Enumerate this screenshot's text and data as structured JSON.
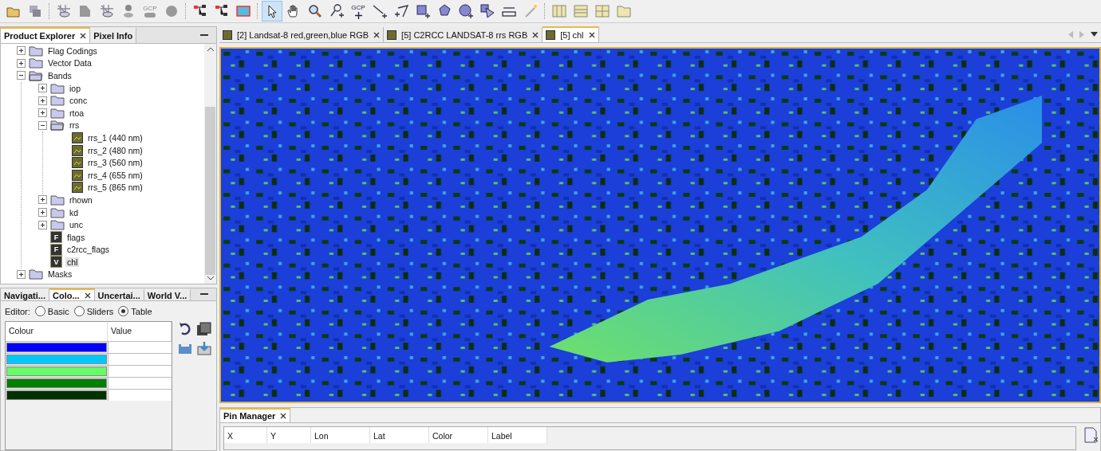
{
  "toolbar": [
    {
      "kind": "open",
      "selected": false
    },
    {
      "kind": "session",
      "selected": false
    },
    {
      "kind": "sep"
    },
    {
      "kind": "hide",
      "selected": false
    },
    {
      "kind": "shape",
      "selected": false
    },
    {
      "kind": "grid",
      "selected": false
    },
    {
      "kind": "pin",
      "selected": false
    },
    {
      "kind": "gcp",
      "label": "GCP",
      "selected": false
    },
    {
      "kind": "blob",
      "selected": false
    },
    {
      "kind": "sep"
    },
    {
      "kind": "graph",
      "selected": false
    },
    {
      "kind": "graph2",
      "selected": false
    },
    {
      "kind": "map",
      "selected": false
    },
    {
      "kind": "sep"
    },
    {
      "kind": "select",
      "selected": true
    },
    {
      "kind": "pan",
      "selected": false
    },
    {
      "kind": "zoom",
      "selected": false
    },
    {
      "kind": "pinadd",
      "selected": false
    },
    {
      "kind": "gcpadd",
      "label": "GCP",
      "selected": false
    },
    {
      "kind": "line",
      "selected": false
    },
    {
      "kind": "polyline",
      "selected": false
    },
    {
      "kind": "rect",
      "selected": false
    },
    {
      "kind": "polygon",
      "selected": false
    },
    {
      "kind": "ellipse",
      "selected": false
    },
    {
      "kind": "shape2",
      "selected": false
    },
    {
      "kind": "ruler",
      "selected": false
    },
    {
      "kind": "wand",
      "selected": false
    },
    {
      "kind": "sep"
    },
    {
      "kind": "tilev",
      "selected": false
    },
    {
      "kind": "tileh",
      "selected": false
    },
    {
      "kind": "tileg",
      "selected": false
    },
    {
      "kind": "folder",
      "selected": false
    }
  ],
  "explorer": {
    "tabs": [
      {
        "label": "Product Explorer",
        "selected": true,
        "closable": true
      },
      {
        "label": "Pixel Info",
        "selected": false,
        "closable": false
      }
    ],
    "tree": [
      {
        "label": "Flag Codings",
        "kind": "folder",
        "expanded": false
      },
      {
        "label": "Vector Data",
        "kind": "folder",
        "expanded": false
      },
      {
        "label": "Bands",
        "kind": "folder",
        "expanded": true,
        "children": [
          {
            "label": "iop",
            "kind": "folder",
            "expanded": false
          },
          {
            "label": "conc",
            "kind": "folder",
            "expanded": false
          },
          {
            "label": "rtoa",
            "kind": "folder",
            "expanded": false
          },
          {
            "label": "rrs",
            "kind": "folder",
            "expanded": true,
            "children": [
              {
                "label": "rrs_1 (440 nm)",
                "kind": "band"
              },
              {
                "label": "rrs_2 (480 nm)",
                "kind": "band"
              },
              {
                "label": "rrs_3 (560 nm)",
                "kind": "band"
              },
              {
                "label": "rrs_4 (655 nm)",
                "kind": "band"
              },
              {
                "label": "rrs_5 (865 nm)",
                "kind": "band"
              }
            ]
          },
          {
            "label": "rhown",
            "kind": "folder",
            "expanded": false
          },
          {
            "label": "kd",
            "kind": "folder",
            "expanded": false
          },
          {
            "label": "unc",
            "kind": "folder",
            "expanded": false
          },
          {
            "label": "flags",
            "kind": "flag",
            "icon_letter": "F"
          },
          {
            "label": "c2rcc_flags",
            "kind": "flag",
            "icon_letter": "F"
          },
          {
            "label": "chl",
            "kind": "virtual",
            "icon_letter": "V",
            "selected": true
          }
        ]
      },
      {
        "label": "Masks",
        "kind": "folder",
        "expanded": false
      }
    ]
  },
  "colour_panel": {
    "tabs": [
      {
        "label": "Navigati...",
        "selected": false,
        "closable": false
      },
      {
        "label": "Colo...",
        "selected": true,
        "closable": true
      },
      {
        "label": "Uncertai...",
        "selected": false,
        "closable": false
      },
      {
        "label": "World V...",
        "selected": false,
        "closable": false
      }
    ],
    "editor_label": "Editor:",
    "editors": [
      {
        "label": "Basic",
        "selected": false
      },
      {
        "label": "Sliders",
        "selected": false
      },
      {
        "label": "Table",
        "selected": true
      }
    ],
    "columns": [
      "Colour",
      "Value"
    ],
    "rows": [
      {
        "color": "#0000ff"
      },
      {
        "color": "#00c8ff"
      },
      {
        "color": "#64ff64"
      },
      {
        "color": "#008000"
      },
      {
        "color": "#003200"
      }
    ]
  },
  "documents": {
    "tabs": [
      {
        "label": "[2] Landsat-8 red,green,blue RGB",
        "selected": false
      },
      {
        "label": "[5] C2RCC LANDSAT-8 rrs RGB",
        "selected": false
      },
      {
        "label": "[5] chl",
        "selected": true
      }
    ]
  },
  "pin_manager": {
    "tab": "Pin Manager",
    "columns": [
      "X",
      "Y",
      "Lon",
      "Lat",
      "Color",
      "Label"
    ]
  }
}
